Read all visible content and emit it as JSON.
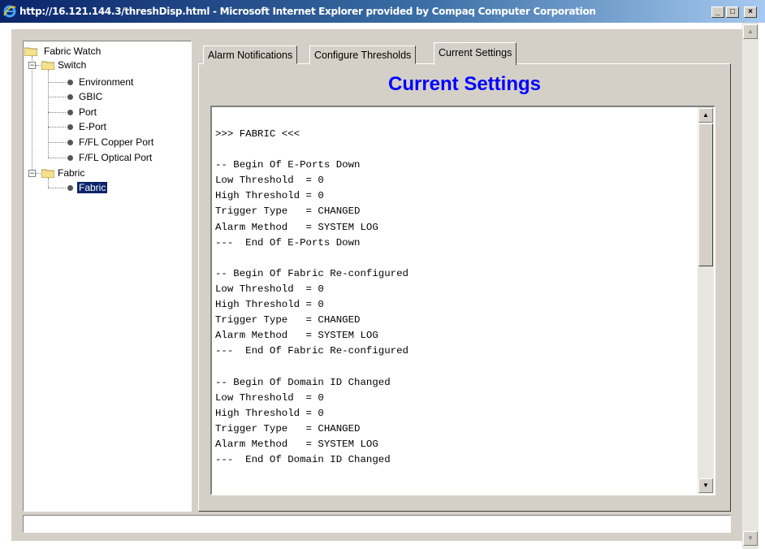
{
  "window": {
    "title": "http://16.121.144.3/threshDisp.html - Microsoft Internet Explorer provided by Compaq Computer Corporation",
    "minimize": "_",
    "maximize": "□",
    "close": "×"
  },
  "tree": {
    "root": "Fabric Watch",
    "switch": "Switch",
    "switch_children": [
      "Environment",
      "GBIC",
      "Port",
      "E-Port",
      "F/FL Copper Port",
      "F/FL Optical Port"
    ],
    "fabric": "Fabric",
    "fabric_children": [
      "Fabric"
    ],
    "selected": "Fabric"
  },
  "tabs": [
    "Alarm Notifications",
    "Configure Thresholds",
    "Current Settings"
  ],
  "active_tab": "Current Settings",
  "heading": "Current Settings",
  "heading_color": "#0000ff",
  "settings_text": ">>> FABRIC <<<\n\n-- Begin Of E-Ports Down\nLow Threshold  = 0\nHigh Threshold = 0\nTrigger Type   = CHANGED\nAlarm Method   = SYSTEM LOG\n---  End Of E-Ports Down\n\n-- Begin Of Fabric Re-configured\nLow Threshold  = 0\nHigh Threshold = 0\nTrigger Type   = CHANGED\nAlarm Method   = SYSTEM LOG\n---  End Of Fabric Re-configured\n\n-- Begin Of Domain ID Changed\nLow Threshold  = 0\nHigh Threshold = 0\nTrigger Type   = CHANGED\nAlarm Method   = SYSTEM LOG\n---  End Of Domain ID Changed"
}
